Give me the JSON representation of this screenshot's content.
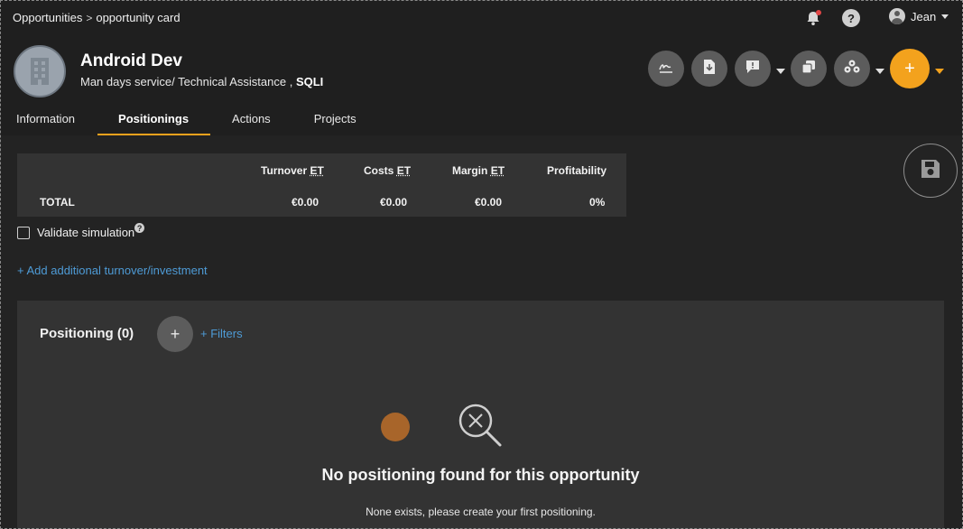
{
  "breadcrumb": {
    "root": "Opportunities",
    "separator": ">",
    "current": "opportunity card"
  },
  "user": {
    "name": "Jean"
  },
  "help": {
    "label": "?"
  },
  "opportunity": {
    "title": "Android Dev",
    "subtitle": "Man days service/ Technical Assistance ,",
    "company": "SQLI"
  },
  "actions": {
    "items": [
      "signature-icon",
      "download-doc-icon",
      "comment-icon",
      "duplicate-icon",
      "group-icon"
    ],
    "add_label": "+",
    "accent": "#f3a21d"
  },
  "tabs": [
    {
      "label": "Information",
      "active": false
    },
    {
      "label": "Positionings",
      "active": true
    },
    {
      "label": "Actions",
      "active": false
    },
    {
      "label": "Projects",
      "active": false
    }
  ],
  "summary": {
    "headers": {
      "turnover": "Turnover",
      "costs": "Costs",
      "margin": "Margin",
      "profitability": "Profitability",
      "et": "ET"
    },
    "row_label": "TOTAL",
    "values": {
      "turnover": "€0.00",
      "costs": "€0.00",
      "margin": "€0.00",
      "profitability": "0%"
    }
  },
  "validate": {
    "label": "Validate simulation",
    "checked": false,
    "hint": "?"
  },
  "add_turnover_link": "+ Add additional turnover/investment",
  "positioning": {
    "title": "Positioning (0)",
    "add_label": "+",
    "filters_label": "+ Filters",
    "empty_title": "No positioning found for this opportunity",
    "empty_subtitle": "None exists, please create your first positioning."
  }
}
